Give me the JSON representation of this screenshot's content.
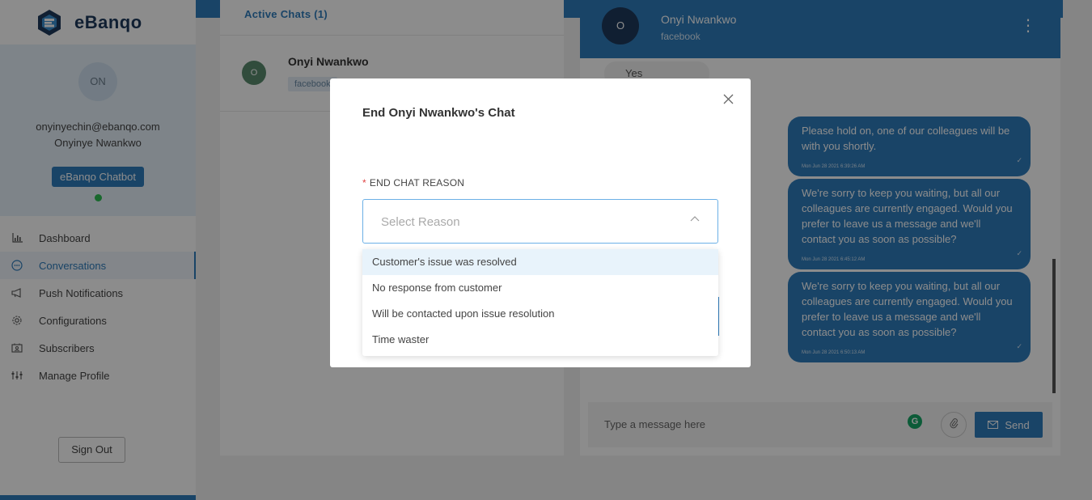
{
  "sidebar": {
    "brand": "eBanqo",
    "profile": {
      "initials": "ON",
      "email": "onyinyechin@ebanqo.com",
      "name": "Onyinye Nwankwo",
      "bot_label": "eBanqo Chatbot"
    },
    "nav": [
      {
        "label": "Dashboard",
        "icon": "bar-chart-icon"
      },
      {
        "label": "Conversations",
        "icon": "chat-bubble-icon",
        "active": true
      },
      {
        "label": "Push Notifications",
        "icon": "megaphone-icon"
      },
      {
        "label": "Configurations",
        "icon": "gear-icon"
      },
      {
        "label": "Subscribers",
        "icon": "contact-card-icon"
      },
      {
        "label": "Manage Profile",
        "icon": "sliders-icon"
      }
    ],
    "sign_out": "Sign Out"
  },
  "chats": {
    "header": "Active Chats (1)",
    "items": [
      {
        "initial": "O",
        "name": "Onyi Nwankwo",
        "tag": "facebook"
      }
    ]
  },
  "conversation": {
    "initial": "O",
    "name": "Onyi Nwankwo",
    "source": "facebook",
    "left_message": "Yes",
    "messages": [
      {
        "text": "Please hold on, one of our colleagues will be with you shortly.",
        "time": "Mon Jun 28 2021 6:39:26 AM"
      },
      {
        "text": "We're sorry to keep you waiting, but all our colleagues are currently engaged. Would you prefer to leave us a message and we'll contact you as soon as possible?",
        "time": "Mon Jun 28 2021 6:45:12 AM"
      },
      {
        "text": "We're sorry to keep you waiting, but all our colleagues are currently engaged. Would you prefer to leave us a message and we'll contact you as soon as possible?",
        "time": "Mon Jun 28 2021 6:50:13 AM"
      }
    ],
    "composer_placeholder": "Type a message here",
    "send_label": "Send"
  },
  "modal": {
    "title": "End Onyi Nwankwo's Chat",
    "field_label": "END CHAT REASON",
    "select_placeholder": "Select Reason",
    "options": [
      "Customer's issue was resolved",
      "No response from customer",
      "Will be contacted upon issue resolution",
      "Time waster"
    ]
  },
  "colors": {
    "accent": "#2f7cbc",
    "online": "#2dbd52",
    "required": "#e04545"
  }
}
